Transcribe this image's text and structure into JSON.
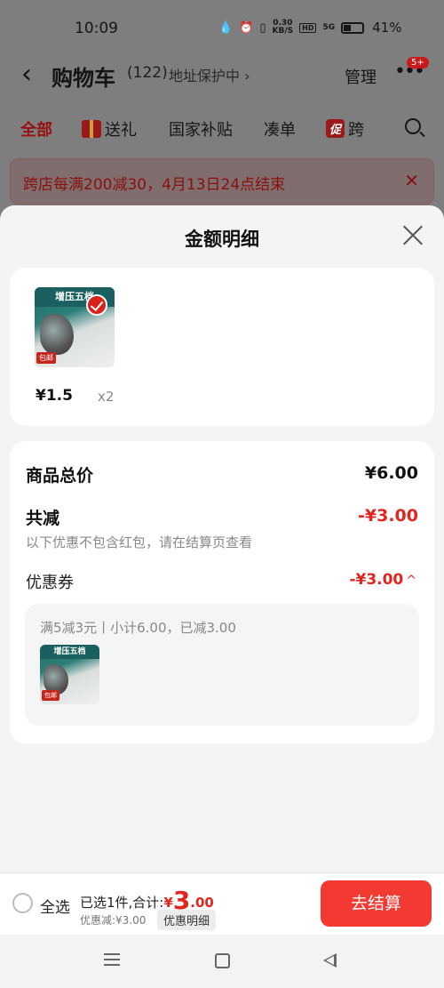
{
  "status_bar": {
    "time": "10:09",
    "network_speed": "0.30",
    "network_unit": "KB/S",
    "hd": "HD",
    "signal": "5G",
    "battery": "41%"
  },
  "header": {
    "title": "购物车",
    "count": "(122)",
    "address_protect": "地址保护中 ›",
    "manage": "管理",
    "badge": "5+"
  },
  "tabs": [
    {
      "label": "全部"
    },
    {
      "label": "送礼"
    },
    {
      "label": "国家补贴"
    },
    {
      "label": "凑单"
    },
    {
      "label": "跨",
      "tag": "促"
    }
  ],
  "promo_banner": {
    "text": "跨店每满200减30，4月13日24点结束"
  },
  "sheet": {
    "title": "金额明细",
    "item": {
      "thumb_title": "增压五档",
      "thumb_tag": "包邮",
      "price": "¥1.5",
      "quantity": "x2"
    },
    "summary": {
      "total_label": "商品总价",
      "total_value": "¥6.00",
      "discount_label": "共减",
      "discount_value": "-¥3.00",
      "discount_note": "以下优惠不包含红包，请在结算页查看",
      "coupon_label": "优惠券",
      "coupon_value": "-¥3.00",
      "coupon_desc": "满5减3元丨小计6.00，已减3.00"
    }
  },
  "bottom_bar": {
    "select_all": "全选",
    "selected_prefix": "已选1件,合计:",
    "currency": "¥",
    "amount_int": "3",
    "amount_dec": ".00",
    "discount_text": "优惠减:¥3.00",
    "detail_chip": "优惠明细",
    "checkout": "去结算"
  },
  "colors": {
    "accent": "#e0261f",
    "checkout_button": "#f23a32",
    "sheet_bg": "#f4f4f4",
    "overlay": "#7e7e7e"
  },
  "icons": {
    "back": "back-arrow-icon",
    "close": "close-icon",
    "search": "search-icon",
    "more": "more-dots-icon",
    "check": "check-icon",
    "gift": "gift-icon"
  }
}
